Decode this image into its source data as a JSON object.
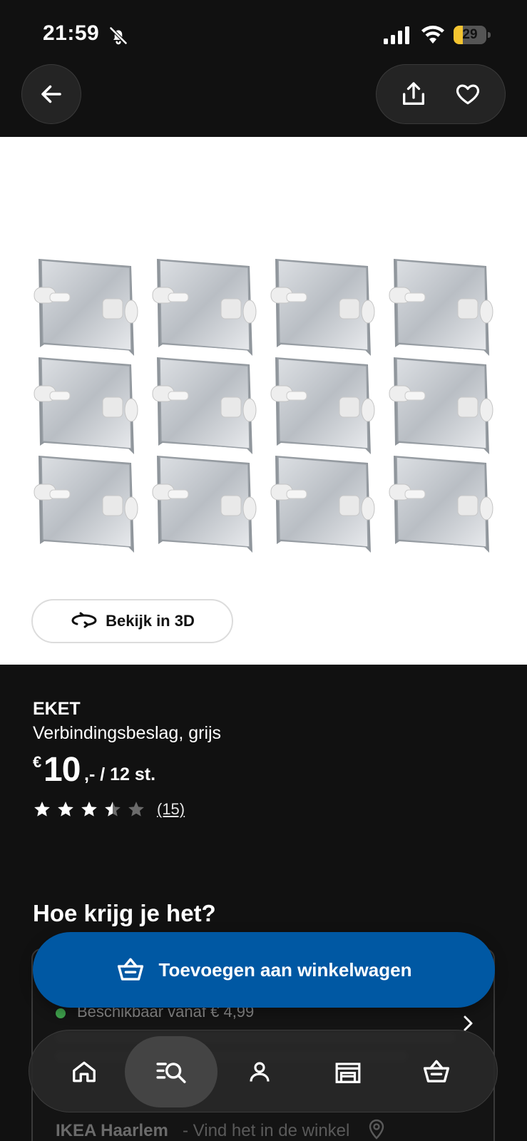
{
  "status_bar": {
    "time": "21:59",
    "battery": "29",
    "battery_level": 0.29
  },
  "header": {
    "back_icon": "arrow-left-icon",
    "share_icon": "share-icon",
    "favorite_icon": "heart-icon"
  },
  "gallery": {
    "view_3d_label": "Bekijk in 3D",
    "view_3d_icon": "rotate-3d-icon",
    "item_count": 12
  },
  "product": {
    "name": "EKET",
    "description": "Verbindingsbeslag, grijs",
    "currency": "€",
    "price": "10",
    "price_suffix": ",- / 12 st.",
    "rating": 3.5,
    "rating_max": 5,
    "review_count": "(15)"
  },
  "delivery": {
    "heading": "Hoe krijg je het?",
    "availability": "Beschikbaar vanaf € 4,99",
    "store_name": "IKEA Haarlem",
    "store_suffix": " - Vind het in de winkel"
  },
  "cart_button": {
    "label": "Toevoegen aan winkelwagen",
    "icon": "basket-icon"
  },
  "bottom_nav": {
    "items": [
      {
        "icon": "home-icon",
        "active": false
      },
      {
        "icon": "search-list-icon",
        "active": true
      },
      {
        "icon": "profile-icon",
        "active": false
      },
      {
        "icon": "store-icon",
        "active": false
      },
      {
        "icon": "basket-icon",
        "active": false
      }
    ]
  },
  "colors": {
    "background": "#111111",
    "ikea_blue": "#0058a3",
    "availability_green": "#3fa34d",
    "battery_yellow": "#f4c430"
  }
}
